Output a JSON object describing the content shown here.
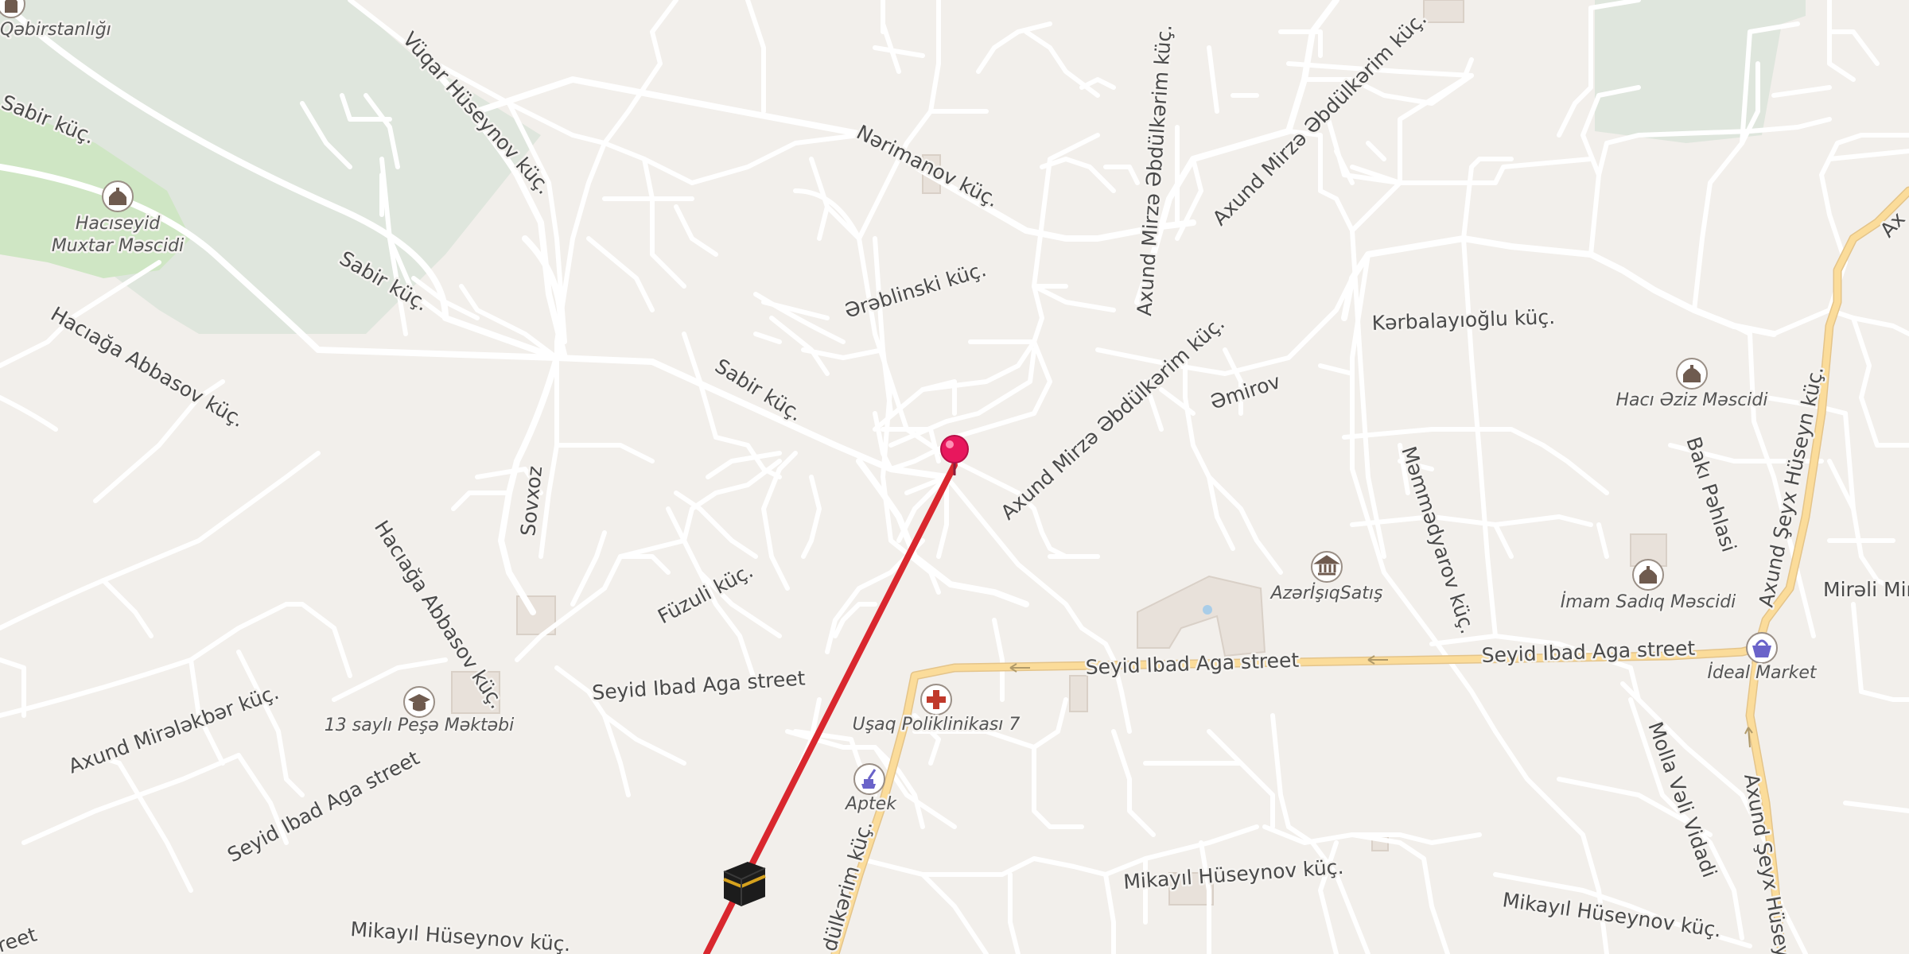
{
  "map": {
    "colors": {
      "background": "#f2efeb",
      "park": "#dfe6dd",
      "grass": "#cfe6c4",
      "minor_road": "#ffffff",
      "main_road": "#fbdc9a",
      "route_line": "#d9272e",
      "pin": "#e8175d"
    },
    "street_labels": {
      "vuqar_huseynov": "Vüqar Hüseynov küç.",
      "narimanov": "Nərimanov küç.",
      "axund_mirza_top": "Axund Mirzə Əbdülkərim küç.",
      "sabir_1": "Sabir küç.",
      "sabir_2": "Sabir küç.",
      "sabir_3": "Sabir küç.",
      "haciaga_abbasov_1": "Hacıağa Abbasov küç.",
      "haciaga_abbasov_2": "Hacıağa Abbasov küç.",
      "arablinski": "Ərəblinski küç.",
      "axund_mirza_vertical": "Axund Mirzə Əbdülkərim küç.",
      "axund_mirza_diag": "Axund Mirzə Əbdülkərim küç.",
      "kerbelayioglu": "Kərbalayıoğlu küç.",
      "amirov": "Əmirov",
      "mammadyarov": "Məmmədyarov küç.",
      "baki_pahlasi": "Bakı Pəhlasi",
      "axund_seyx_1": "Axund Şeyx Hüseyn küç.",
      "axund_seyx_2": "Axund Şeyx Hüseyn",
      "axund_top_right": "Ax",
      "mirali_mir": "Mirəli Mir",
      "soyxoz": "Sovxoz",
      "fuzuli": "Füzuli küç.",
      "seyid_ibad_1": "Seyid Ibad Aga street",
      "seyid_ibad_2": "Seyid Ibad Aga street",
      "seyid_ibad_3": "Seyid Ibad Aga street",
      "seyid_ibad_4": "Seyid Ibad Aga street",
      "axund_miralakbar": "Axund Mirələkbər küç.",
      "molla_vali_vidadi": "Molla Vəli Vidadi",
      "mikayil_1": "Mikayıl Hüseynov küç.",
      "mikayil_2": "Mikayıl Hüseynov küç.",
      "mikayil_3": "Mikayıl Hüseynov küç.",
      "street_bottom_left": "reet",
      "kerim_bottom": "dülkərim küç."
    },
    "pois": {
      "cemetery": {
        "label": "Qəbirstanlığı",
        "icon": "cemetery-icon"
      },
      "haciseyid_mosque": {
        "label_line1": "Hacıseyid",
        "label_line2": "Muxtar Məscidi",
        "icon": "mosque-icon"
      },
      "haci_aziz_mosque": {
        "label": "Hacı Əziz Məscidi",
        "icon": "mosque-icon"
      },
      "azerisiq": {
        "label": "AzərİşıqSatış",
        "icon": "bank-icon"
      },
      "imam_sadiq_mosque": {
        "label": "İmam Sadıq Məscidi",
        "icon": "mosque-icon"
      },
      "ideal_market": {
        "label": "İdeal Market",
        "icon": "shopping-basket-icon"
      },
      "school_13": {
        "label": "13 saylı Peşə Məktəbi",
        "icon": "graduation-cap-icon"
      },
      "child_clinic": {
        "label": "Uşaq Poliklinikası 7",
        "icon": "medical-cross-icon"
      },
      "pharmacy": {
        "label": "Aptek",
        "icon": "pharmacy-icon"
      }
    },
    "markers": {
      "pin": "location-pin-icon",
      "qibla": "kaaba-icon"
    }
  }
}
